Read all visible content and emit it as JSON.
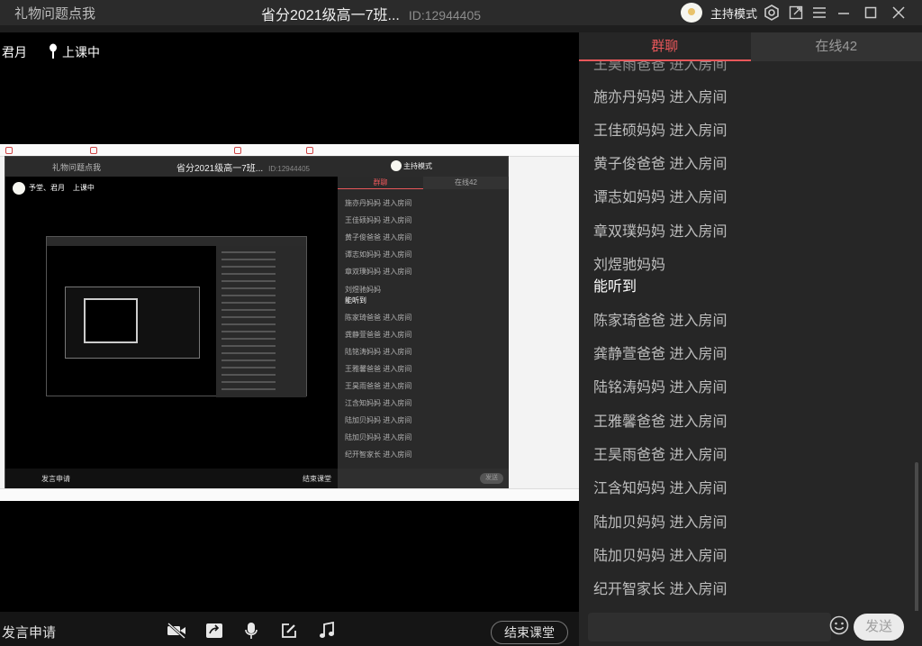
{
  "titlebar": {
    "left_text": "礼物问题点我",
    "title": "省分2021级高一7班...",
    "room_id": "ID:12944405",
    "host_mode": "主持模式"
  },
  "video": {
    "teacher_name": "君月",
    "status": "上课中"
  },
  "nested": {
    "left_text": "礼物问题点我",
    "title": "省分2021级高一7班...",
    "room_id": "ID:12944405",
    "host_mode": "主持模式",
    "teacher": "予堂、君月",
    "status": "上课中",
    "tab_chat": "群聊",
    "tab_online": "在线42",
    "speak": "发言申请",
    "end": "结束课堂",
    "send": "发送",
    "messages": [
      "施亦丹妈妈 进入房间",
      "王佳硕妈妈 进入房间",
      "黄子俊爸爸 进入房间",
      "谭志如妈妈 进入房间",
      "章双璞妈妈 进入房间",
      "刘煜驰妈妈",
      "能听到",
      "陈家琦爸爸 进入房间",
      "龚静萱爸爸 进入房间",
      "陆铭涛妈妈 进入房间",
      "王雅馨爸爸 进入房间",
      "王昊雨爸爸 进入房间",
      "江含知妈妈 进入房间",
      "陆加贝妈妈 进入房间",
      "陆加贝妈妈 进入房间",
      "纪开智家长 进入房间"
    ]
  },
  "bottombar": {
    "speak_request": "发言申请",
    "end_class": "结束课堂"
  },
  "chat": {
    "tab_group": "群聊",
    "tab_online": "在线42",
    "messages": [
      "王昊雨爸爸 进入房间",
      "施亦丹妈妈 进入房间",
      "王佳硕妈妈 进入房间",
      "黄子俊爸爸 进入房间",
      "谭志如妈妈 进入房间",
      "章双璞妈妈 进入房间",
      "刘煜驰妈妈",
      "能听到",
      "陈家琦爸爸 进入房间",
      "龚静萱爸爸 进入房间",
      "陆铭涛妈妈 进入房间",
      "王雅馨爸爸 进入房间",
      "王昊雨爸爸 进入房间",
      "江含知妈妈 进入房间",
      "陆加贝妈妈 进入房间",
      "陆加贝妈妈 进入房间",
      "纪开智家长 进入房间"
    ],
    "input_value": "",
    "send_label": "发送"
  },
  "colors": {
    "accent": "#e8575a",
    "panel": "#262626",
    "titlebar": "#2b2b2b"
  }
}
